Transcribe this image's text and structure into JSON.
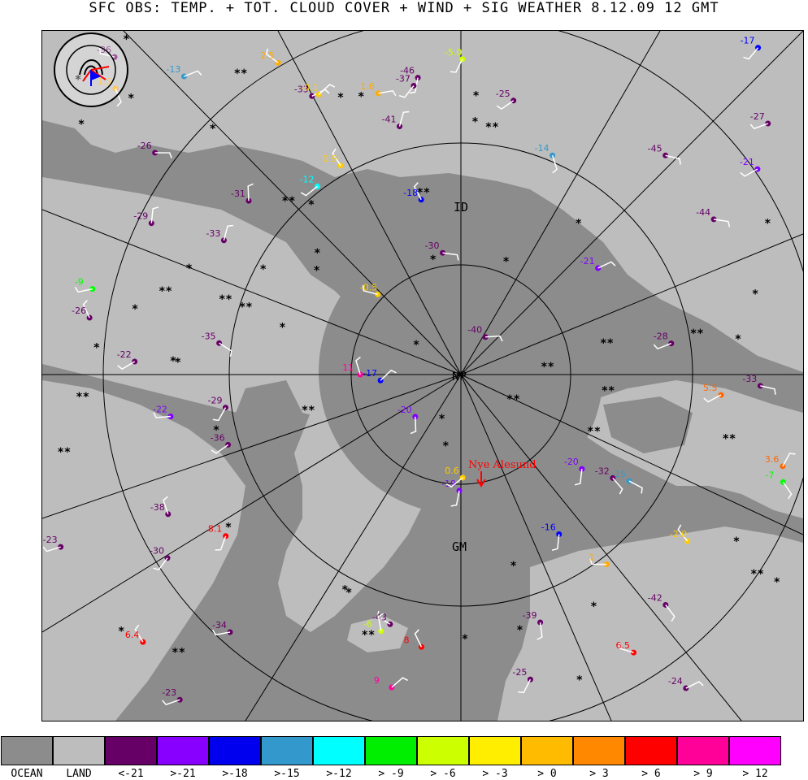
{
  "title": "SFC OBS: TEMP. + TOT. CLOUD COVER + WIND + SIG WEATHER 8.12.09 12  GMT",
  "logo": {
    "text": "IGM - Bereich Meteorologie · Universität zu Köln"
  },
  "map": {
    "grid_labels": [
      "ID",
      "NP",
      "GM"
    ],
    "station_label": "Nye Alesund",
    "colors": {
      "ocean": "#8c8c8c",
      "land": "#bdbdbd",
      "grid": "#000000"
    }
  },
  "observations": [
    {
      "t": "-20",
      "c": "#8000ff"
    },
    {
      "t": "-17",
      "c": "#0000ff"
    },
    {
      "t": "-15",
      "c": "#3399cc"
    },
    {
      "t": "-18",
      "c": "#0000ff"
    },
    {
      "t": "-22",
      "c": "#8000ff"
    },
    {
      "t": "-13",
      "c": "#3399cc"
    },
    {
      "t": "-27",
      "c": "#660066"
    },
    {
      "t": "-21",
      "c": "#8000ff"
    },
    {
      "t": "-19",
      "c": "#8000ff"
    },
    {
      "t": "-23",
      "c": "#660066"
    },
    {
      "t": "-29",
      "c": "#660066"
    },
    {
      "t": "-30",
      "c": "#660066"
    },
    {
      "t": "-33",
      "c": "#660066"
    },
    {
      "t": "-34",
      "c": "#660066"
    },
    {
      "t": "-36",
      "c": "#660066"
    },
    {
      "t": "-32",
      "c": "#660066"
    },
    {
      "t": "-35",
      "c": "#660066"
    },
    {
      "t": "-26",
      "c": "#660066"
    },
    {
      "t": "-25",
      "c": "#660066"
    },
    {
      "t": "-28",
      "c": "#660066"
    },
    {
      "t": "-31",
      "c": "#660066"
    },
    {
      "t": "-29",
      "c": "#660066"
    },
    {
      "t": "-24",
      "c": "#660066"
    },
    {
      "t": "-2.0",
      "c": "#ffcc00"
    },
    {
      "t": "-5.0",
      "c": "#ccff00"
    },
    {
      "t": "-12",
      "c": "#00ffff"
    },
    {
      "t": "-16",
      "c": "#0000ff"
    },
    {
      "t": "-17",
      "c": "#0000ff"
    },
    {
      "t": "-40",
      "c": "#660066"
    },
    {
      "t": "-43",
      "c": "#660066"
    },
    {
      "t": "-41",
      "c": "#660066"
    },
    {
      "t": "-44",
      "c": "#660066"
    },
    {
      "t": "-38",
      "c": "#660066"
    },
    {
      "t": "-39",
      "c": "#660066"
    },
    {
      "t": "-45",
      "c": "#660066"
    },
    {
      "t": "-36",
      "c": "#660066"
    },
    {
      "t": "-42",
      "c": "#660066"
    },
    {
      "t": "-46",
      "c": "#660066"
    },
    {
      "t": "-37",
      "c": "#660066"
    },
    {
      "t": "-33",
      "c": "#660066"
    },
    {
      "t": "-26",
      "c": "#660066"
    },
    {
      "t": "-25",
      "c": "#660066"
    },
    {
      "t": "-22",
      "c": "#660066"
    },
    {
      "t": "-23",
      "c": "#660066"
    },
    {
      "t": "-21",
      "c": "#8000ff"
    },
    {
      "t": "-20",
      "c": "#8000ff"
    },
    {
      "t": "-0.1",
      "c": "#ffcc00"
    },
    {
      "t": "1.5",
      "c": "#ffaa00"
    },
    {
      "t": "2.5",
      "c": "#ffaa00"
    },
    {
      "t": "-0.5",
      "c": "#ffcc00"
    },
    {
      "t": "5.5",
      "c": "#ff6600"
    },
    {
      "t": "6.4",
      "c": "#ff0000"
    },
    {
      "t": "8",
      "c": "#ff0000"
    },
    {
      "t": "9",
      "c": "#ff0099"
    },
    {
      "t": "11",
      "c": "#ff0099"
    },
    {
      "t": "6.5",
      "c": "#ff0000"
    },
    {
      "t": "3.6",
      "c": "#ff6600"
    },
    {
      "t": "1.6",
      "c": "#ffaa00"
    },
    {
      "t": "0.6",
      "c": "#ffcc00"
    },
    {
      "t": "1",
      "c": "#ffaa00"
    },
    {
      "t": "-6",
      "c": "#ccff00"
    },
    {
      "t": "-9",
      "c": "#00ff00"
    },
    {
      "t": "-7",
      "c": "#00ff00"
    },
    {
      "t": "-14",
      "c": "#3399cc"
    },
    {
      "t": "-30",
      "c": "#660066"
    },
    {
      "t": "-33",
      "c": "#660066"
    },
    {
      "t": "0.9",
      "c": "#ffcc00"
    },
    {
      "t": "8.1",
      "c": "#ff0000"
    }
  ],
  "legend": [
    {
      "label": "OCEAN",
      "color": "#8c8c8c"
    },
    {
      "label": "LAND",
      "color": "#bdbdbd"
    },
    {
      "label": "<-21",
      "color": "#660066"
    },
    {
      "label": ">-21",
      "color": "#8800ff"
    },
    {
      "label": ">-18",
      "color": "#0000ee"
    },
    {
      "label": ">-15",
      "color": "#3399cc"
    },
    {
      "label": ">-12",
      "color": "#00ffff"
    },
    {
      "label": "> -9",
      "color": "#00ee00"
    },
    {
      "label": "> -6",
      "color": "#ccff00"
    },
    {
      "label": "> -3",
      "color": "#ffee00"
    },
    {
      "label": "> 0",
      "color": "#ffbb00"
    },
    {
      "label": "> 3",
      "color": "#ff8800"
    },
    {
      "label": "> 6",
      "color": "#ff0000"
    },
    {
      "label": "> 9",
      "color": "#ff0099"
    },
    {
      "label": "> 12",
      "color": "#ff00ff"
    }
  ]
}
